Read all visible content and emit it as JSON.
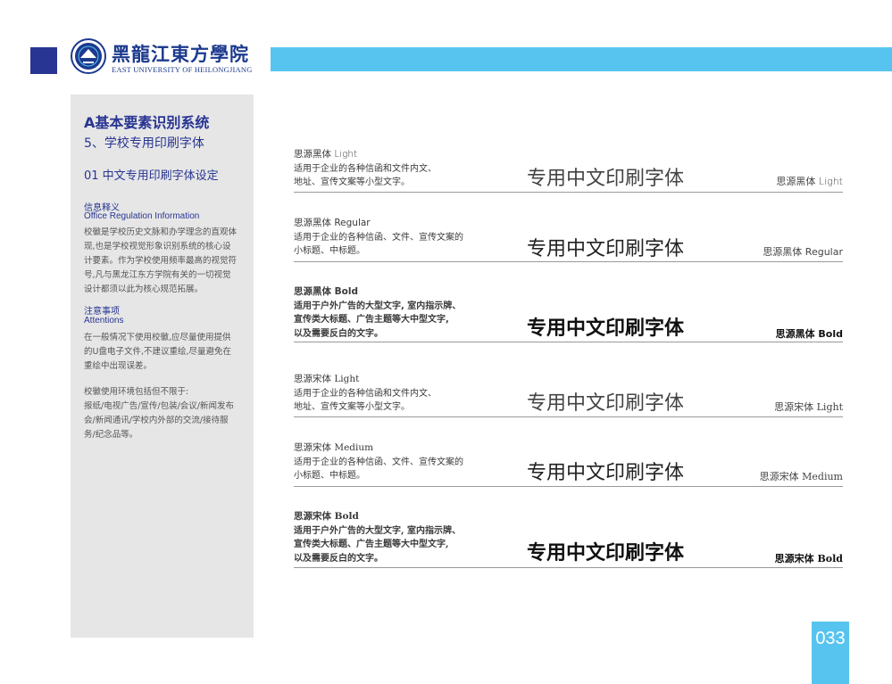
{
  "header": {
    "logo_cn": "黑龍江東方學院",
    "logo_en": "EAST UNIVERSITY OF HEILONGJIANG",
    "bar_color": "#57c4ef",
    "accent_color": "#283592"
  },
  "sidebar": {
    "title": "A基本要素识别系统",
    "subtitle": "5、学校专用印刷字体",
    "section": "01 中文专用印刷字体设定",
    "info_heading": "信息释义",
    "info_heading_en": "Office Regulation Information",
    "info_lines": [
      "校徽是学校历史文脉和办学理念的直观体",
      "现,也是学校视觉形象识别系统的核心设",
      "计要素。作为学校使用频率最高的视觉符",
      "号,凡与黑龙江东方学院有关的一切视觉",
      "设计都须以此为核心规范拓展。"
    ],
    "attention_heading": "注意事项",
    "attention_heading_en": "Attentions",
    "attention_lines": [
      "在一般情况下使用校徽,应尽量使用提供",
      "的U盘电子文件,不建议重绘,尽量避免在",
      "重绘中出现误差。"
    ],
    "usage_lines": [
      "校徽使用环境包括但不限于:",
      "报纸/电视广告/宣传/包装/会议/新闻发布",
      "会/新闻通讯/学校内外部的交流/接待服",
      "务/纪念品等。"
    ]
  },
  "fonts": [
    {
      "name": "思源黑体  Light",
      "desc": [
        "适用于企业的各种信函和文件内文、",
        "地址、宣传文案等小型文字。"
      ],
      "sample": "专用中文印刷字体",
      "label": "思源黑体  Light"
    },
    {
      "name": "思源黑体  Regular",
      "desc": [
        "适用于企业的各种信函、文件、宣传文案的",
        "小标题、中标题。"
      ],
      "sample": "专用中文印刷字体",
      "label": "思源黑体  Regular"
    },
    {
      "name": "思源黑体  Bold",
      "desc": [
        "适用于户外广告的大型文字, 室内指示牌、",
        "宣传类大标题、广告主题等大中型文字,",
        "以及需要反白的文字。"
      ],
      "sample": "专用中文印刷字体",
      "label": "思源黑体  Bold"
    },
    {
      "name": "思源宋体  Light",
      "desc": [
        "适用于企业的各种信函和文件内文、",
        "地址、宣传文案等小型文字。"
      ],
      "sample": "专用中文印刷字体",
      "label": "思源宋体  Light"
    },
    {
      "name": "思源宋体  Medium",
      "desc": [
        "适用于企业的各种信函、文件、宣传文案的",
        "小标题、中标题。"
      ],
      "sample": "专用中文印刷字体",
      "label": "思源宋体  Medium"
    },
    {
      "name": "思源宋体  Bold",
      "desc": [
        "适用于户外广告的大型文字, 室内指示牌、",
        "宣传类大标题、广告主题等大中型文字,",
        "以及需要反白的文字。"
      ],
      "sample": "专用中文印刷字体",
      "label": "思源宋体  Bold"
    }
  ],
  "page_number": "033"
}
